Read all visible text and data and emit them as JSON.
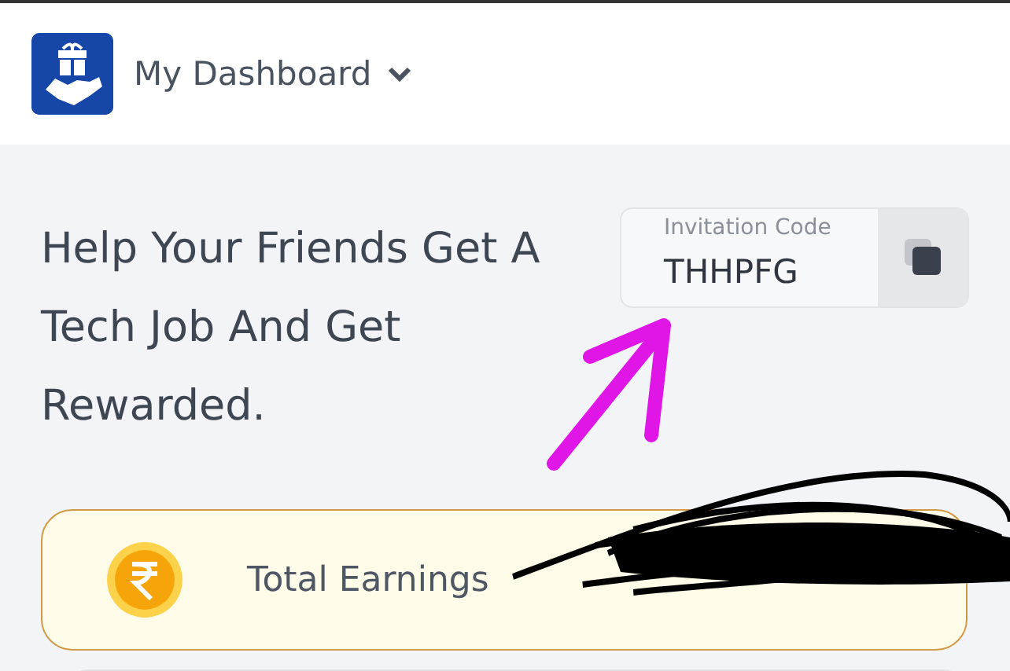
{
  "header": {
    "title": "My Dashboard"
  },
  "referral": {
    "heading": "Help Your Friends Get A Tech Job And Get Rewarded.",
    "code_label": "Invitation Code",
    "code": "THHPFG"
  },
  "earnings": {
    "label": "Total Earnings"
  }
}
